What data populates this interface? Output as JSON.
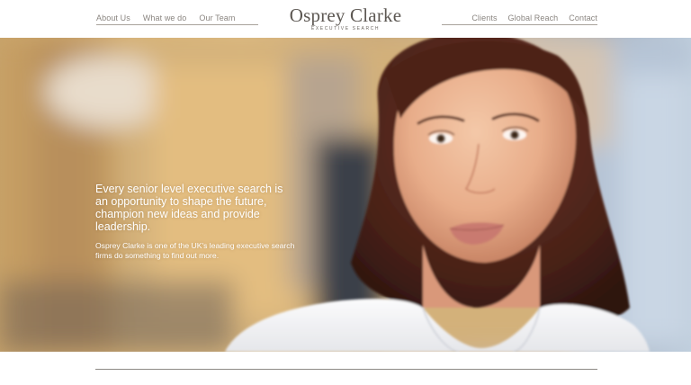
{
  "nav": {
    "left": [
      {
        "label": "About Us"
      },
      {
        "label": "What we do"
      },
      {
        "label": "Our Team"
      }
    ],
    "right": [
      {
        "label": "Clients"
      },
      {
        "label": "Global Reach"
      },
      {
        "label": "Contact"
      }
    ]
  },
  "logo": {
    "name": "Osprey Clarke",
    "tagline": "EXECUTIVE SEARCH"
  },
  "hero": {
    "headline": "Every senior level executive search is an opportunity to shape the future, champion new ideas and provide leadership.",
    "subtext": "Osprey Clarke is one of the UK's leading executive search firms do something to find out more."
  },
  "colors": {
    "nav_text": "#8a8580",
    "logo_text": "#5c5752",
    "rule": "#a8a29c",
    "hero_text": "#ffffff"
  }
}
